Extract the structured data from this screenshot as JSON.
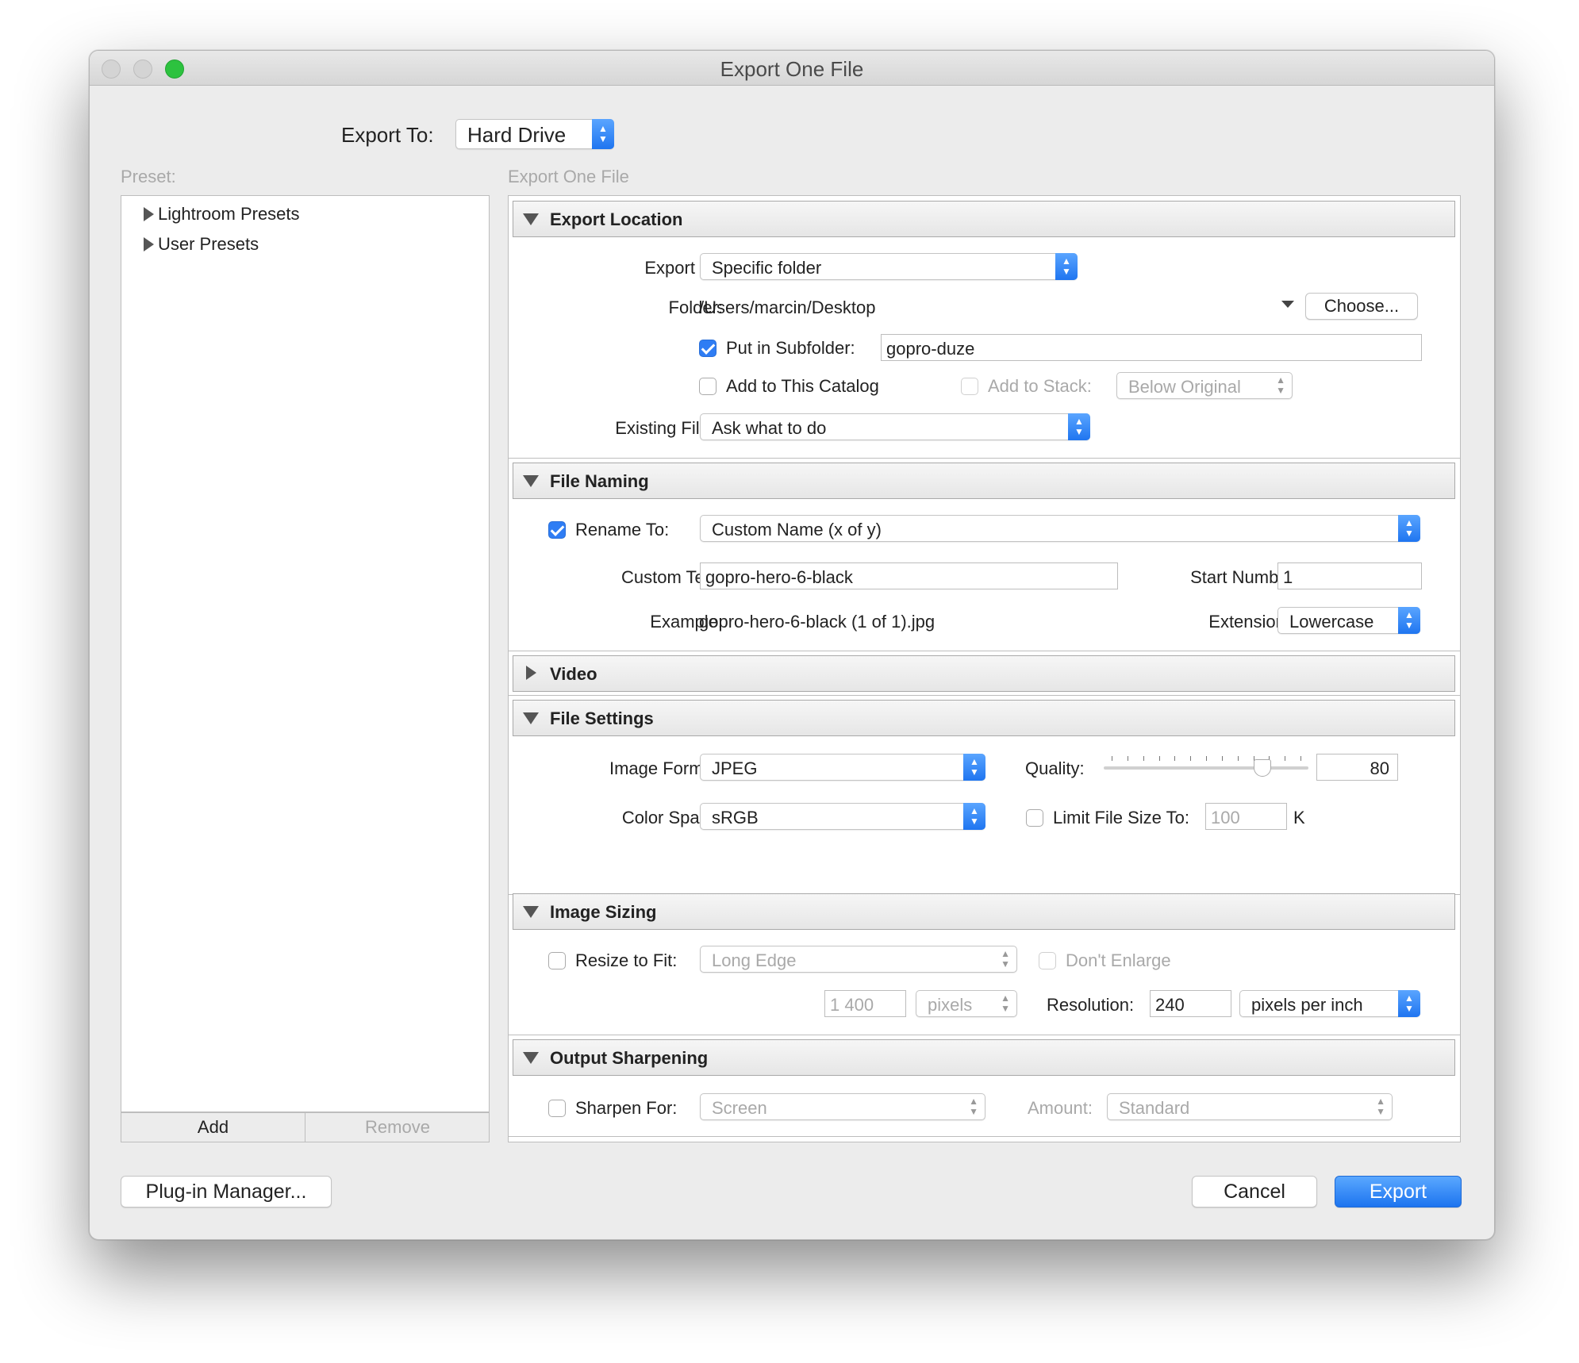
{
  "window": {
    "title": "Export One File"
  },
  "top": {
    "export_to_label": "Export To:",
    "export_to_value": "Hard Drive"
  },
  "left": {
    "preset_label": "Preset:",
    "presets": [
      "Lightroom Presets",
      "User Presets"
    ],
    "add_label": "Add",
    "remove_label": "Remove"
  },
  "right": {
    "heading": "Export One File",
    "export_location": {
      "title": "Export Location",
      "export_to_label": "Export To:",
      "export_to_value": "Specific folder",
      "folder_label": "Folder:",
      "folder_value": "/Users/marcin/Desktop",
      "choose_label": "Choose...",
      "subfolder_label": "Put in Subfolder:",
      "subfolder_checked": true,
      "subfolder_value": "gopro-duze",
      "catalog_label": "Add to This Catalog",
      "catalog_checked": false,
      "stack_label": "Add to Stack:",
      "stack_checked": false,
      "stack_value": "Below Original",
      "existing_label": "Existing Files:",
      "existing_value": "Ask what to do"
    },
    "file_naming": {
      "title": "File Naming",
      "rename_label": "Rename To:",
      "rename_checked": true,
      "rename_value": "Custom Name (x of y)",
      "custom_text_label": "Custom Text:",
      "custom_text_value": "gopro-hero-6-black",
      "start_number_label": "Start Number:",
      "start_number_value": "1",
      "example_label": "Example:",
      "example_value": "gopro-hero-6-black (1 of 1).jpg",
      "extensions_label": "Extensions:",
      "extensions_value": "Lowercase"
    },
    "video": {
      "title": "Video"
    },
    "file_settings": {
      "title": "File Settings",
      "format_label": "Image Format:",
      "format_value": "JPEG",
      "quality_label": "Quality:",
      "quality_value": "80",
      "quality_fraction": 0.8,
      "color_space_label": "Color Space:",
      "color_space_value": "sRGB",
      "limit_label": "Limit File Size To:",
      "limit_checked": false,
      "limit_value": "100",
      "limit_unit": "K"
    },
    "image_sizing": {
      "title": "Image Sizing",
      "resize_label": "Resize to Fit:",
      "resize_checked": false,
      "resize_value": "Long Edge",
      "dont_enlarge_label": "Don't Enlarge",
      "size_value": "1 400",
      "size_unit": "pixels",
      "resolution_label": "Resolution:",
      "resolution_value": "240",
      "resolution_unit": "pixels per inch"
    },
    "output_sharpening": {
      "title": "Output Sharpening",
      "sharpen_label": "Sharpen For:",
      "sharpen_checked": false,
      "sharpen_value": "Screen",
      "amount_label": "Amount:",
      "amount_value": "Standard"
    }
  },
  "bottom": {
    "plugin_manager_label": "Plug-in Manager...",
    "cancel_label": "Cancel",
    "export_label": "Export"
  },
  "colors": {
    "accent": "#2f7df4",
    "window_bg": "#ececec"
  }
}
